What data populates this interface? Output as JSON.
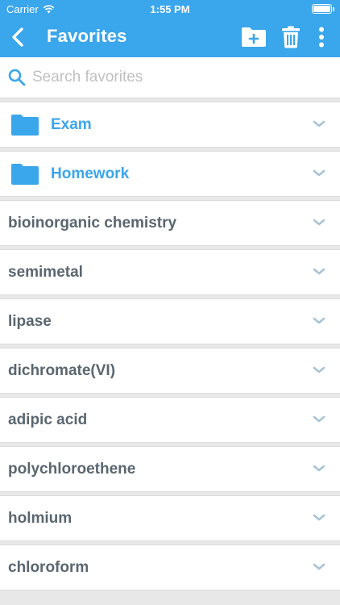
{
  "status_bar": {
    "carrier": "Carrier",
    "time": "1:55 PM"
  },
  "nav": {
    "title": "Favorites"
  },
  "search": {
    "placeholder": "Search favorites",
    "value": ""
  },
  "colors": {
    "accent": "#3aa6ec",
    "item_text": "#5a6670",
    "chevron": "#a9c3d6"
  },
  "folders": [
    {
      "label": "Exam",
      "icon": "folder-icon"
    },
    {
      "label": "Homework",
      "icon": "folder-icon"
    }
  ],
  "items": [
    {
      "label": "bioinorganic chemistry"
    },
    {
      "label": "semimetal"
    },
    {
      "label": "lipase"
    },
    {
      "label": "dichromate(VI)"
    },
    {
      "label": "adipic acid"
    },
    {
      "label": "polychloroethene"
    },
    {
      "label": "holmium"
    },
    {
      "label": "chloroform"
    }
  ]
}
